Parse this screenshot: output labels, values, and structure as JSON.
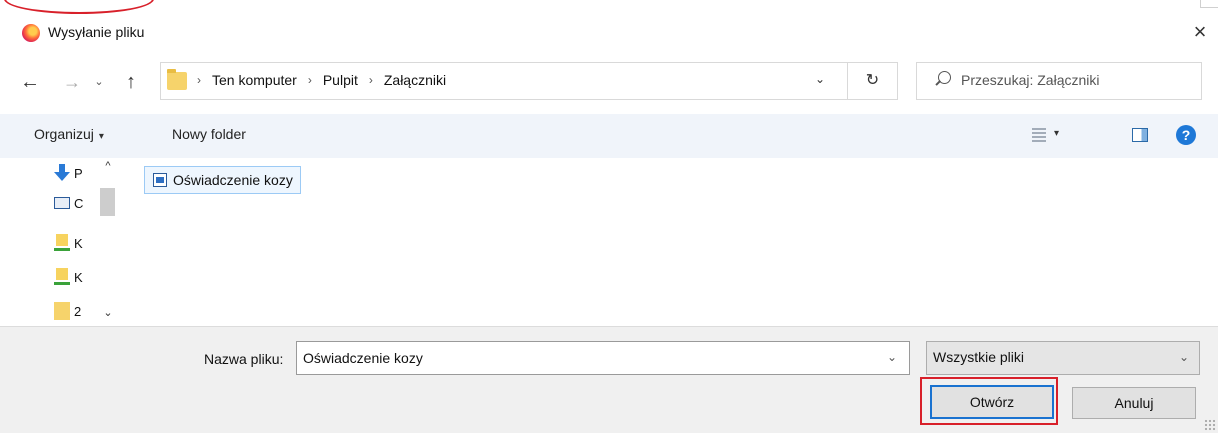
{
  "window": {
    "title": "Wysyłanie pliku",
    "close_glyph": "×"
  },
  "navigation": {
    "back_glyph": "←",
    "forward_glyph": "→",
    "recent_glyph": "⌄",
    "up_glyph": "↑",
    "breadcrumb": [
      "Ten komputer",
      "Pulpit",
      "Załączniki"
    ],
    "separator": "›",
    "dropdown_glyph": "⌄",
    "refresh_glyph": "↻",
    "search_placeholder": "Przeszukaj: Załączniki"
  },
  "toolbar": {
    "organize_label": "Organizuj",
    "organize_caret": "▾",
    "new_folder_label": "Nowy folder",
    "views_caret": "▾",
    "help_glyph": "?"
  },
  "nav_pane": {
    "items": [
      {
        "icon": "downloads-icon",
        "label": "P"
      },
      {
        "icon": "desktop-icon",
        "label": "C"
      },
      {
        "icon": "network-folder-icon",
        "label": "K"
      },
      {
        "icon": "network-folder-icon",
        "label": "K"
      },
      {
        "icon": "folder-icon",
        "label": "2"
      }
    ],
    "scroll_up_glyph": "^",
    "scroll_down_glyph": "⌄"
  },
  "files": [
    {
      "name": "Oświadczenie kozy",
      "icon": "image-file-icon",
      "selected": true
    }
  ],
  "footer": {
    "filename_label": "Nazwa pliku:",
    "filename_value": "Oświadczenie kozy",
    "filename_dropdown_glyph": "⌄",
    "filetype_value": "Wszystkie pliki",
    "filetype_dropdown_glyph": "⌄",
    "open_button": "Otwórz",
    "cancel_button": "Anuluj"
  },
  "colors": {
    "annotation_red": "#d8202a",
    "accent_blue": "#1a72d0",
    "toolbar_bg": "#f0f4fa",
    "footer_bg": "#f0f0f0"
  }
}
